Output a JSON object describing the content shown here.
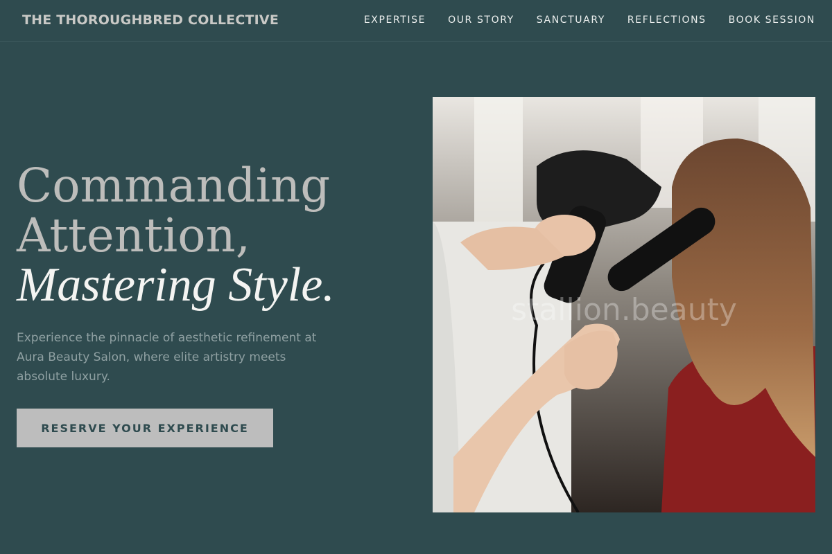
{
  "brand": {
    "name": "THE THOROUGHBRED COLLECTIVE"
  },
  "nav": {
    "items": [
      "EXPERTISE",
      "OUR STORY",
      "SANCTUARY",
      "REFLECTIONS",
      "BOOK SESSION"
    ]
  },
  "hero": {
    "title_line1": "Commanding",
    "title_line2": "Attention,",
    "title_accent": "Mastering Style.",
    "subtitle": "Experience the pinnacle of aesthetic refinement at Aura Beauty Salon, where elite artistry meets absolute luxury.",
    "cta_label": "RESERVE YOUR EXPERIENCE"
  },
  "image": {
    "watermark": "stallion.beauty",
    "alt": "Stylist blow-drying a client's hair with a round brush"
  },
  "colors": {
    "background": "#2f4b4f",
    "button": "#bdbdbd",
    "title": "#bdbdbb",
    "accent_title": "#f4f4f2"
  }
}
